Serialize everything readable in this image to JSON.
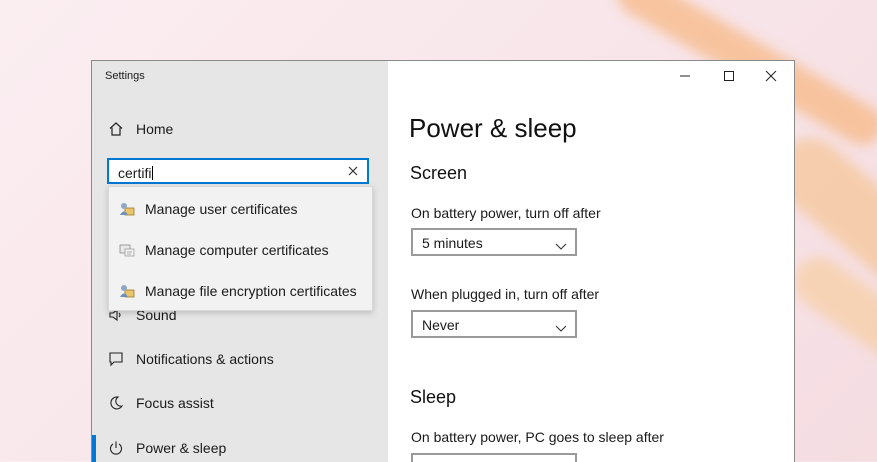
{
  "window": {
    "title": "Settings",
    "caption_buttons": [
      "minimize-icon",
      "maximize-icon",
      "close-icon"
    ]
  },
  "sidebar": {
    "home_label": "Home",
    "search": {
      "value": "certifi"
    },
    "suggestions": [
      {
        "label": "Manage user certificates",
        "icon": "user-certificate-icon"
      },
      {
        "label": "Manage computer certificates",
        "icon": "computer-certificate-icon"
      },
      {
        "label": "Manage file encryption certificates",
        "icon": "file-encryption-certificate-icon"
      }
    ],
    "items": [
      {
        "label": "Sound",
        "icon": "speaker-icon"
      },
      {
        "label": "Notifications & actions",
        "icon": "notification-icon"
      },
      {
        "label": "Focus assist",
        "icon": "moon-icon"
      },
      {
        "label": "Power & sleep",
        "icon": "power-icon",
        "active": true
      }
    ]
  },
  "main": {
    "title": "Power & sleep",
    "screen": {
      "heading": "Screen",
      "battery_label": "On battery power, turn off after",
      "battery_value": "5 minutes",
      "plugged_label": "When plugged in, turn off after",
      "plugged_value": "Never"
    },
    "sleep": {
      "heading": "Sleep",
      "battery_label": "On battery power, PC goes to sleep after"
    }
  },
  "colors": {
    "accent": "#0078d4",
    "sidebar_bg": "#e6e6e6",
    "wallpaper_streak": "#f6b26b"
  }
}
